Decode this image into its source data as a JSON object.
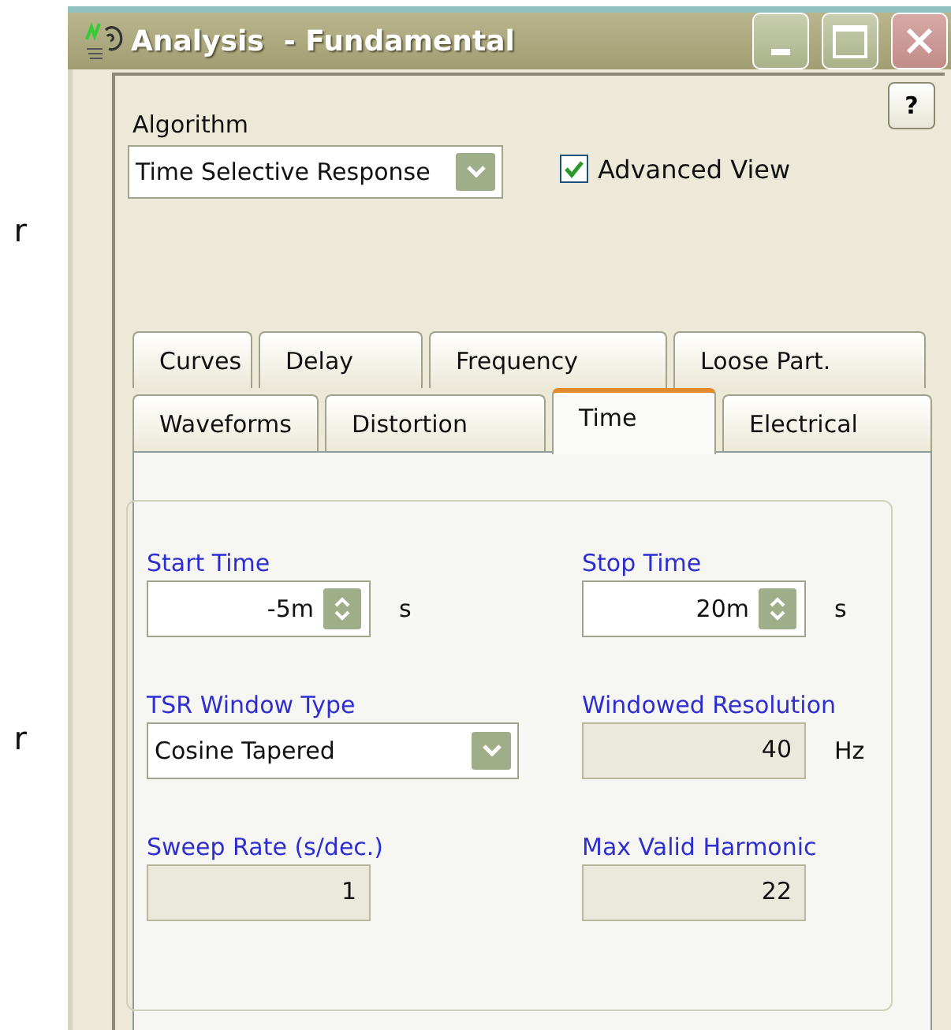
{
  "background_text": [
    "r",
    "r"
  ],
  "window": {
    "title": "Analysis  - Fundamental"
  },
  "help_button": "?",
  "algorithm": {
    "label": "Algorithm",
    "value": "Time Selective Response"
  },
  "advanced_view": {
    "label": "Advanced View",
    "checked": true
  },
  "tab_rows": [
    [
      {
        "label": "Curves",
        "selected": false
      },
      {
        "label": "Delay",
        "selected": false
      },
      {
        "label": "Frequency",
        "selected": false
      },
      {
        "label": "Loose Part.",
        "selected": false
      }
    ],
    [
      {
        "label": "Waveforms",
        "selected": false
      },
      {
        "label": "Distortion",
        "selected": false
      },
      {
        "label": "Time",
        "selected": true
      },
      {
        "label": "Electrical",
        "selected": false
      }
    ]
  ],
  "fields": [
    {
      "kind": "spin",
      "label": "Start Time",
      "value": "-5m",
      "unit": "s"
    },
    {
      "kind": "spin",
      "label": "Stop Time",
      "value": "20m",
      "unit": "s"
    },
    {
      "kind": "combo",
      "label": "TSR Window Type",
      "value": "Cosine Tapered"
    },
    {
      "kind": "readonly",
      "label": "Windowed Resolution",
      "value": "40",
      "unit": "Hz"
    },
    {
      "kind": "readonly",
      "label": "Sweep Rate (s/dec.)",
      "value": "1"
    },
    {
      "kind": "readonly",
      "label": "Max Valid Harmonic",
      "value": "22"
    }
  ]
}
